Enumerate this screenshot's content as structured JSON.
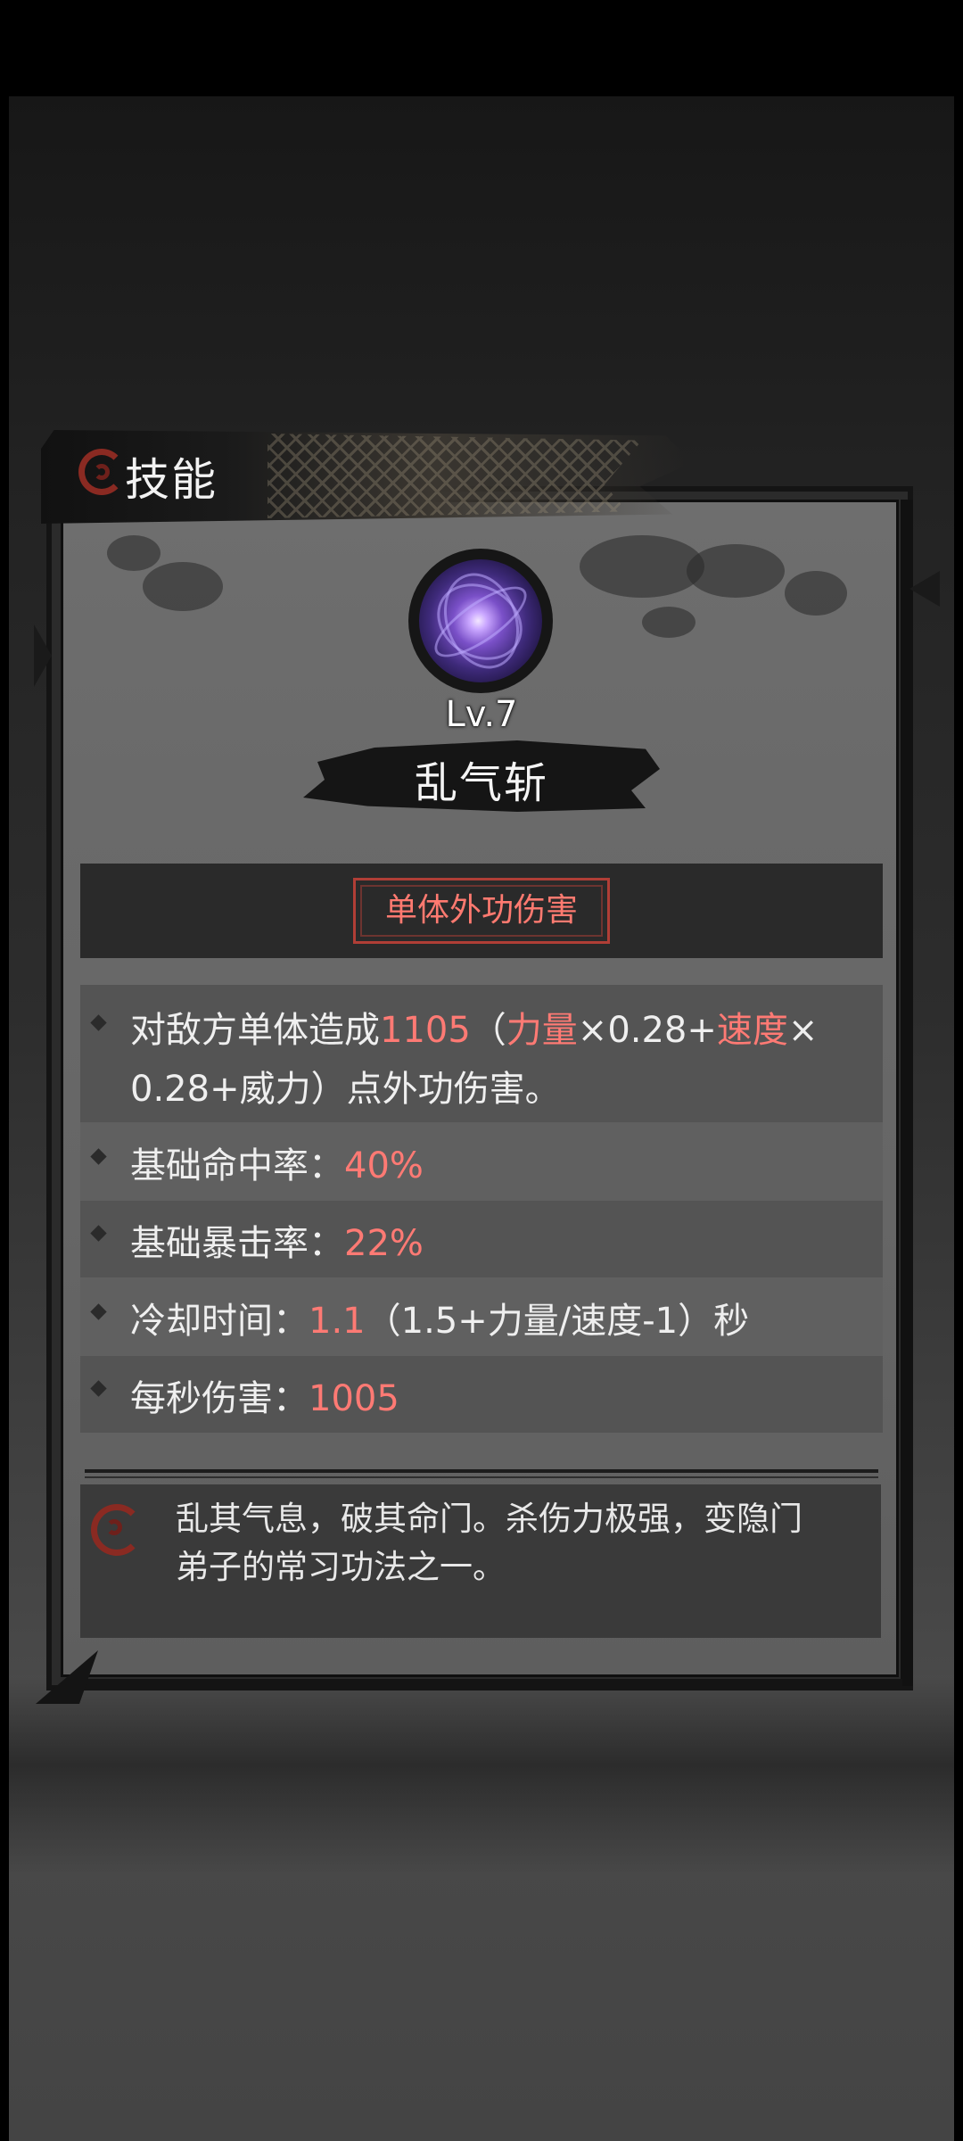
{
  "header": {
    "title": "技能",
    "icon": "swirl-icon"
  },
  "skill": {
    "level": "Lv.7",
    "name": "乱气斩",
    "type": "单体外功伤害",
    "icon": "purple-orb-icon"
  },
  "stats": {
    "damage": {
      "prefix": "对敌方单体造成",
      "value": "1105",
      "open": "（",
      "attr1": "力量",
      "mid1": "×0.28+",
      "attr2": "速度",
      "mid2": "×",
      "line2": "0.28+威力）点外功伤害。"
    },
    "hit_rate": {
      "label": "基础命中率：",
      "value": "40%"
    },
    "crit_rate": {
      "label": "基础暴击率：",
      "value": "22%"
    },
    "cooldown": {
      "label": "冷却时间：",
      "value": "1.1",
      "formula": "（1.5+力量/速度-1）秒"
    },
    "dps": {
      "label": "每秒伤害：",
      "value": "1005"
    }
  },
  "description": {
    "line1": "乱其气息，破其命门。杀伤力极强，变隐门",
    "line2": "弟子的常习功法之一。"
  },
  "colors": {
    "highlight": "#ff7a74",
    "type_border": "#b03e36",
    "panel": "#666666"
  }
}
